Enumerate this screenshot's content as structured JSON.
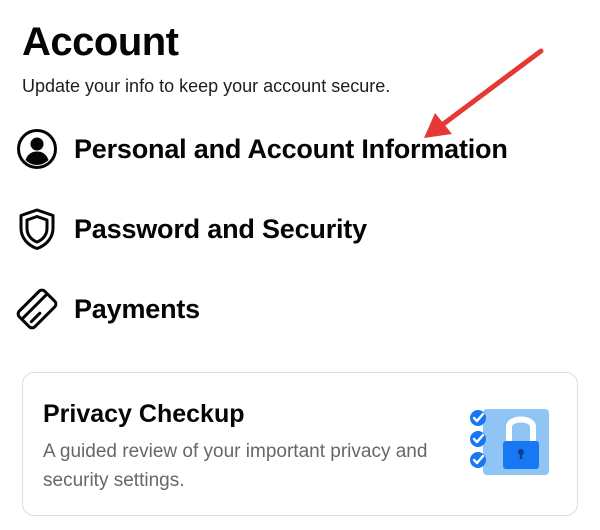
{
  "header": {
    "title": "Account",
    "subtitle": "Update your info to keep your account secure."
  },
  "menu": {
    "items": [
      {
        "label": "Personal and Account Information",
        "icon": "person-circle-icon"
      },
      {
        "label": "Password and Security",
        "icon": "shield-icon"
      },
      {
        "label": "Payments",
        "icon": "credit-card-icon"
      }
    ]
  },
  "privacy_card": {
    "title": "Privacy Checkup",
    "description": "A guided review of your important privacy and security settings.",
    "icon": "padlock-checklist-illustration"
  },
  "annotation": {
    "icon": "red-arrow-icon",
    "color": "#e53935"
  },
  "colors": {
    "text_primary": "#050505",
    "text_secondary": "#65676b",
    "card_border": "#dadde1",
    "accent_blue": "#1877f2",
    "illustration_light_blue": "#8ec5f5"
  }
}
